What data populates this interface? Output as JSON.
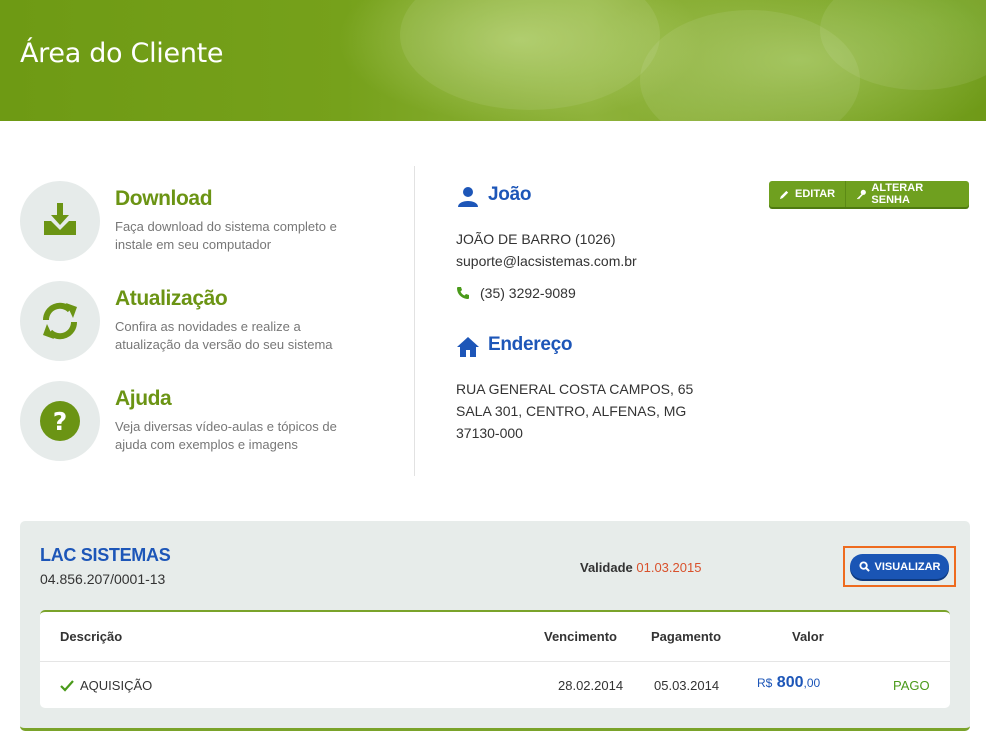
{
  "header": {
    "title": "Área do Cliente"
  },
  "features": [
    {
      "icon": "download-tray-icon",
      "title": "Download",
      "desc": "Faça download do sistema completo e instale em seu computador"
    },
    {
      "icon": "refresh-icon",
      "title": "Atualização",
      "desc": "Confira as novidades e realize a atualização da versão do seu sistema"
    },
    {
      "icon": "question-icon",
      "title": "Ajuda",
      "desc": "Veja diversas vídeo-aulas e tópicos de ajuda com exemplos e imagens"
    }
  ],
  "profile": {
    "title": "João",
    "name_line": "JOÃO DE BARRO (1026)",
    "email": "suporte@lacsistemas.com.br",
    "phone": "(35) 3292-9089",
    "edit_label": "EDITAR",
    "change_password_label": "ALTERAR SENHA"
  },
  "address": {
    "title": "Endereço",
    "line1": "RUA GENERAL COSTA CAMPOS, 65",
    "line2": "SALA 301, CENTRO, ALFENAS, MG",
    "line3": "37130-000"
  },
  "company": {
    "name": "LAC SISTEMAS",
    "cnpj": "04.856.207/0001-13",
    "validity_label": "Validade",
    "validity_date": "01.03.2015",
    "view_label": "VISUALIZAR"
  },
  "table": {
    "headers": {
      "description": "Descrição",
      "due": "Vencimento",
      "payment": "Pagamento",
      "value": "Valor"
    },
    "rows": [
      {
        "description": "AQUISIÇÃO",
        "due": "28.02.2014",
        "payment": "05.03.2014",
        "currency": "R$",
        "value_int": "800",
        "value_dec": ",00",
        "status": "PAGO"
      }
    ]
  },
  "colors": {
    "accent_green": "#6b9414",
    "accent_blue": "#1d56b8",
    "highlight_orange": "#ee6b1f",
    "validity_red": "#d9512c"
  }
}
